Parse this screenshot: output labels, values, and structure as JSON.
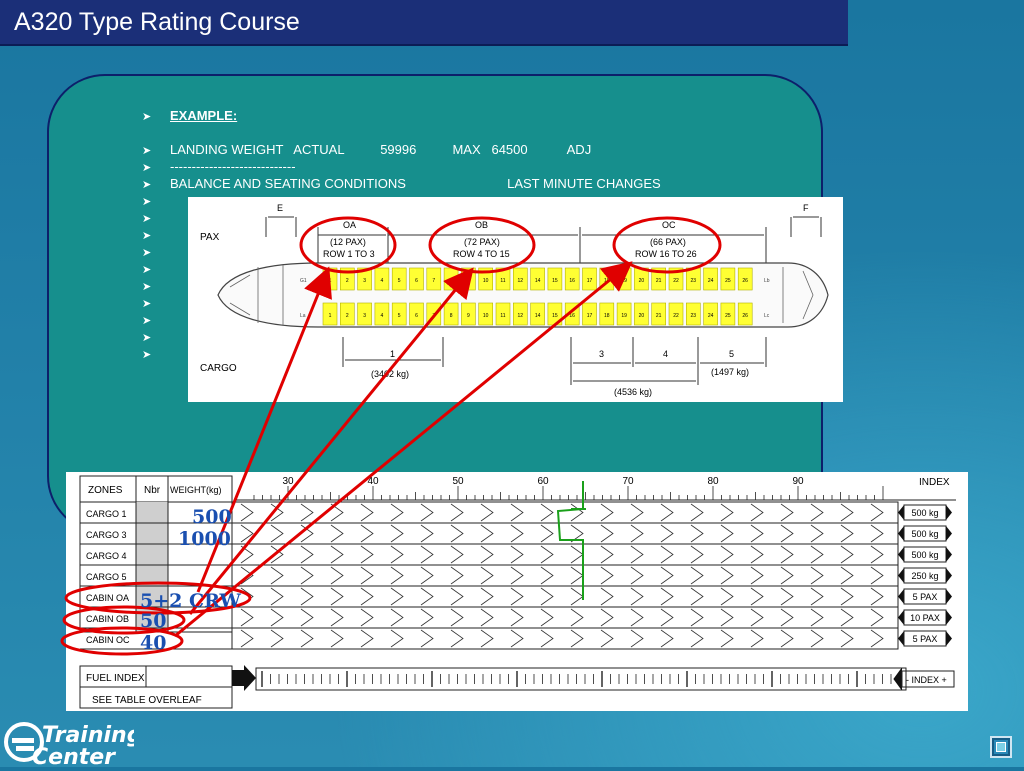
{
  "header": {
    "title": "A320 Type Rating Course"
  },
  "bullets": [
    {
      "text": "EXAMPLE:",
      "style": "heading"
    },
    {
      "text": "LANDING WEIGHT   ACTUAL          59996          MAX   64500           ADJ"
    },
    {
      "text": "-----------------------------"
    },
    {
      "text": "BALANCE AND SEATING CONDITIONS                            LAST MINUTE CHANGES"
    },
    {
      "text": ""
    },
    {
      "text": ""
    },
    {
      "text": ""
    },
    {
      "text": ""
    },
    {
      "text": ""
    },
    {
      "text": ""
    },
    {
      "text": ""
    },
    {
      "text": ""
    },
    {
      "text": ""
    },
    {
      "text": ""
    }
  ],
  "seat_figure": {
    "row_labels": {
      "pax": "PAX",
      "cargo": "CARGO"
    },
    "small_labels": {
      "e": "E",
      "f": "F"
    },
    "zones": [
      {
        "name": "OA",
        "pax": "(12 PAX)",
        "rows": "ROW 1 TO 3"
      },
      {
        "name": "OB",
        "pax": "(72 PAX)",
        "rows": "ROW 4 TO 15"
      },
      {
        "name": "OC",
        "pax": "(66 PAX)",
        "rows": "ROW 16 TO 26"
      }
    ],
    "holds": [
      {
        "label": "1",
        "weight": "(3402 kg)"
      },
      {
        "label": "3",
        "weight": ""
      },
      {
        "label": "4",
        "weight": ""
      },
      {
        "label": "5",
        "weight": "(1497 kg)"
      }
    ],
    "holds_34_weight": "(4536 kg)",
    "seat_rows_top": [
      "1",
      "2",
      "3",
      "4",
      "5",
      "6",
      "7",
      "8",
      "9",
      "10",
      "11",
      "12",
      "14",
      "15",
      "16",
      "17",
      "18",
      "19",
      "20",
      "21",
      "22",
      "23",
      "24",
      "25",
      "26"
    ],
    "seat_rows_bottom": [
      "1",
      "2",
      "3",
      "4",
      "5",
      "6",
      "7",
      "8",
      "9",
      "10",
      "11",
      "12",
      "14",
      "15",
      "16",
      "17",
      "18",
      "19",
      "20",
      "21",
      "22",
      "23",
      "24",
      "25",
      "26"
    ],
    "door_labels": {
      "g1": "G1",
      "la": "La",
      "lb": "Lb",
      "lc": "Lc"
    }
  },
  "loadsheet": {
    "headers": {
      "zones": "ZONES",
      "nbr": "Nbr",
      "weight": "WEIGHT(kg)",
      "index": "INDEX"
    },
    "scale_ticks": [
      "30",
      "40",
      "50",
      "60",
      "70",
      "80",
      "90"
    ],
    "rows": [
      {
        "zone": "CARGO 1",
        "step": "500 kg"
      },
      {
        "zone": "CARGO 3",
        "step": "500 kg"
      },
      {
        "zone": "CARGO 4",
        "step": "500 kg"
      },
      {
        "zone": "CARGO 5",
        "step": "250 kg"
      },
      {
        "zone": "CABIN OA",
        "step": "5 PAX"
      },
      {
        "zone": "CABIN OB",
        "step": "10 PAX"
      },
      {
        "zone": "CABIN OC",
        "step": "5 PAX"
      }
    ],
    "fuel_index": "FUEL INDEX",
    "see_table": "SEE TABLE OVERLEAF",
    "index_pm": "- INDEX +"
  },
  "annotations": {
    "cargo1": "500",
    "cargo3": "1000",
    "cabin_oa": "5+2 CRW",
    "cabin_ob": "50",
    "cabin_oc": "40"
  },
  "colors": {
    "title_bar": "#1b2f78",
    "panel": "#168f8d",
    "seat": "#ffff33",
    "highlight": "#e00000",
    "green_mark": "#1aa01a",
    "annotation": "#1a4fb0"
  },
  "logo": {
    "line1": "Training",
    "line2": "Center"
  }
}
